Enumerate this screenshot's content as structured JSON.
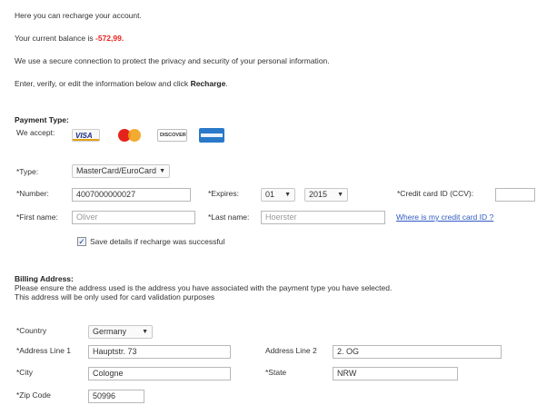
{
  "intro": {
    "line1": "Here you can recharge your account.",
    "balance_label": "Your current balance is",
    "balance_value": "-572,99.",
    "secure_text": "We use a secure connection to protect the privacy and security of your personal information.",
    "enter_text": "Enter, verify, or edit the information below and click",
    "enter_bold": "Recharge",
    "enter_end": "."
  },
  "payment": {
    "title": "Payment Type:",
    "we_accept": "We accept:",
    "cards": [
      "VISA",
      "MasterCard",
      "DISCOVER",
      "AMERICAN EXPRESS"
    ],
    "type_label": "*Type:",
    "type_value": "MasterCard/EuroCard",
    "number_label": "*Number:",
    "number_value": "4007000000027",
    "expires_label": "*Expires:",
    "expires_month": "01",
    "expires_year": "2015",
    "ccv_label": "*Credit card ID (CCV):",
    "ccv_value": "",
    "firstname_label": "*First name:",
    "firstname_placeholder": "Oliver",
    "lastname_label": "*Last name:",
    "lastname_placeholder": "Hoerster",
    "where_link": "Where is my credit card ID ?",
    "save_details": "Save details if recharge was successful",
    "save_checked": true
  },
  "billing": {
    "title": "Billing Address:",
    "desc1": "Please ensure the address used is the address you have associated with the payment type you have selected.",
    "desc2": "This address will be only used for card validation purposes",
    "country_label": "*Country",
    "country_value": "Germany",
    "addr1_label": "*Address Line 1",
    "addr1_value": "Hauptstr. 73",
    "addr2_label": "Address Line 2",
    "addr2_value": "2. OG",
    "city_label": "*City",
    "city_value": "Cologne",
    "state_label": "*State",
    "state_value": "NRW",
    "zip_label": "*Zip Code",
    "zip_value": "50996"
  },
  "colors": {
    "balance": "#e8231e",
    "link": "#2f59c2"
  }
}
